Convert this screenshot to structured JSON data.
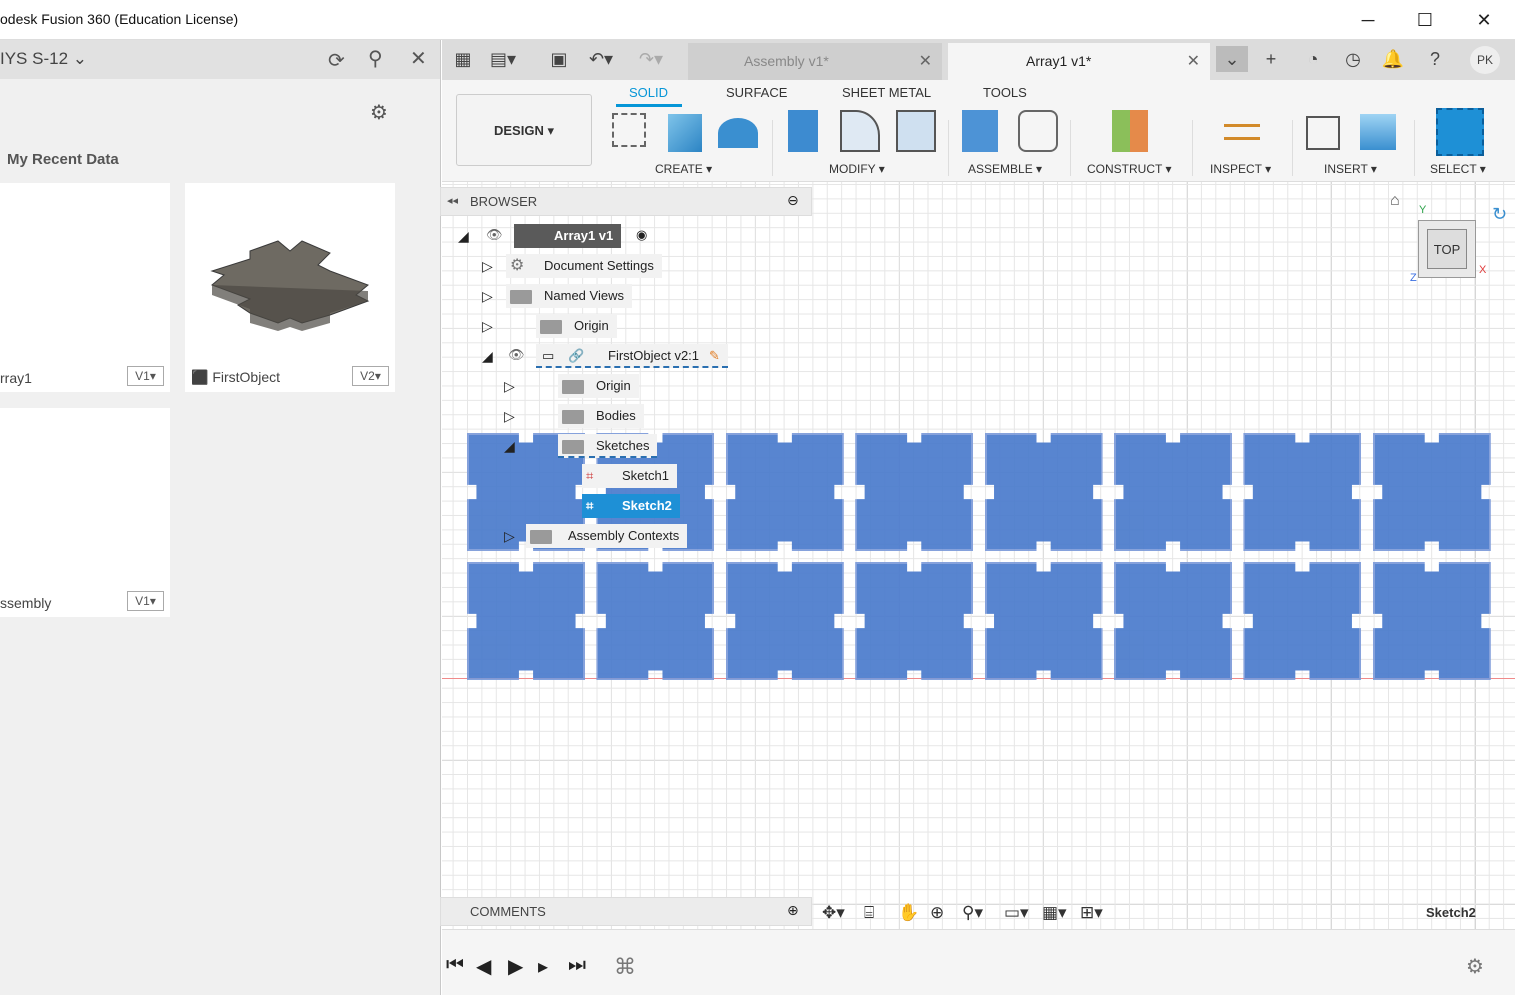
{
  "window": {
    "title": "odesk Fusion 360 (Education License)",
    "min": "─",
    "max": "☐",
    "close": "✕"
  },
  "data_panel": {
    "project": "IYS S-12",
    "section": "My Recent Data",
    "cards": [
      {
        "name": "rray1",
        "version": "V1▾"
      },
      {
        "name": "FirstObject",
        "version": "V2▾"
      },
      {
        "name": "ssembly",
        "version": "V1▾"
      }
    ]
  },
  "tabs": [
    {
      "label": "Assembly v1*"
    },
    {
      "label": "Array1 v1*"
    }
  ],
  "user_initials": "PK",
  "ribbon": {
    "design": "DESIGN ▾",
    "tabs": [
      "SOLID",
      "SURFACE",
      "SHEET METAL",
      "TOOLS"
    ],
    "groups": [
      "CREATE ▾",
      "MODIFY ▾",
      "ASSEMBLE ▾",
      "CONSTRUCT ▾",
      "INSPECT ▾",
      "INSERT ▾",
      "SELECT ▾"
    ]
  },
  "browser": {
    "title": "BROWSER",
    "nodes": [
      "Array1 v1",
      "Document Settings",
      "Named Views",
      "Origin",
      "FirstObject v2:1",
      "Origin",
      "Bodies",
      "Sketches",
      "Sketch1",
      "Sketch2",
      "Assembly Contexts"
    ]
  },
  "viewcube": {
    "face": "TOP",
    "x": "X",
    "y": "Y",
    "z": "Z"
  },
  "comments": "COMMENTS",
  "status": "Sketch2",
  "colors": {
    "accent": "#0696d7",
    "tile": "#4a7bcc",
    "selected": "#1e90d6"
  }
}
